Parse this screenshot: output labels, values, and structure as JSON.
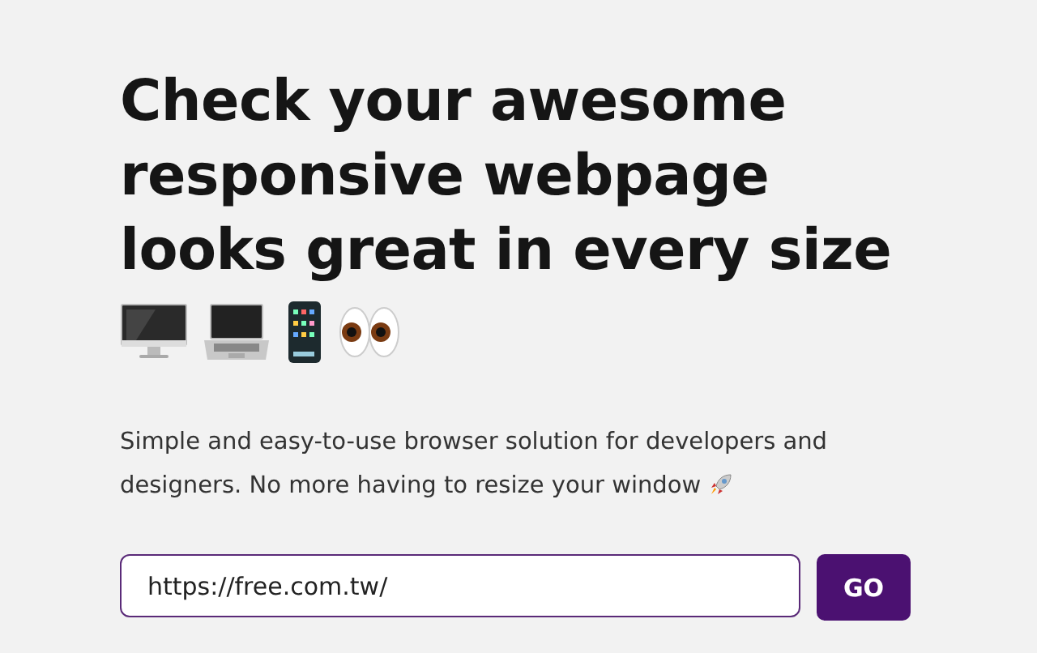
{
  "heading": "Check your awesome responsive webpage looks great in every size",
  "device_icons": [
    {
      "kind": "desktop"
    },
    {
      "kind": "laptop"
    },
    {
      "kind": "phone"
    },
    {
      "kind": "eyes"
    }
  ],
  "description_lines": [
    "Simple and easy-to-use browser solution for developers and",
    "designers. No more having to resize your window"
  ],
  "url_field": {
    "value": "https://free.com.tw/"
  },
  "go_button": "GO"
}
